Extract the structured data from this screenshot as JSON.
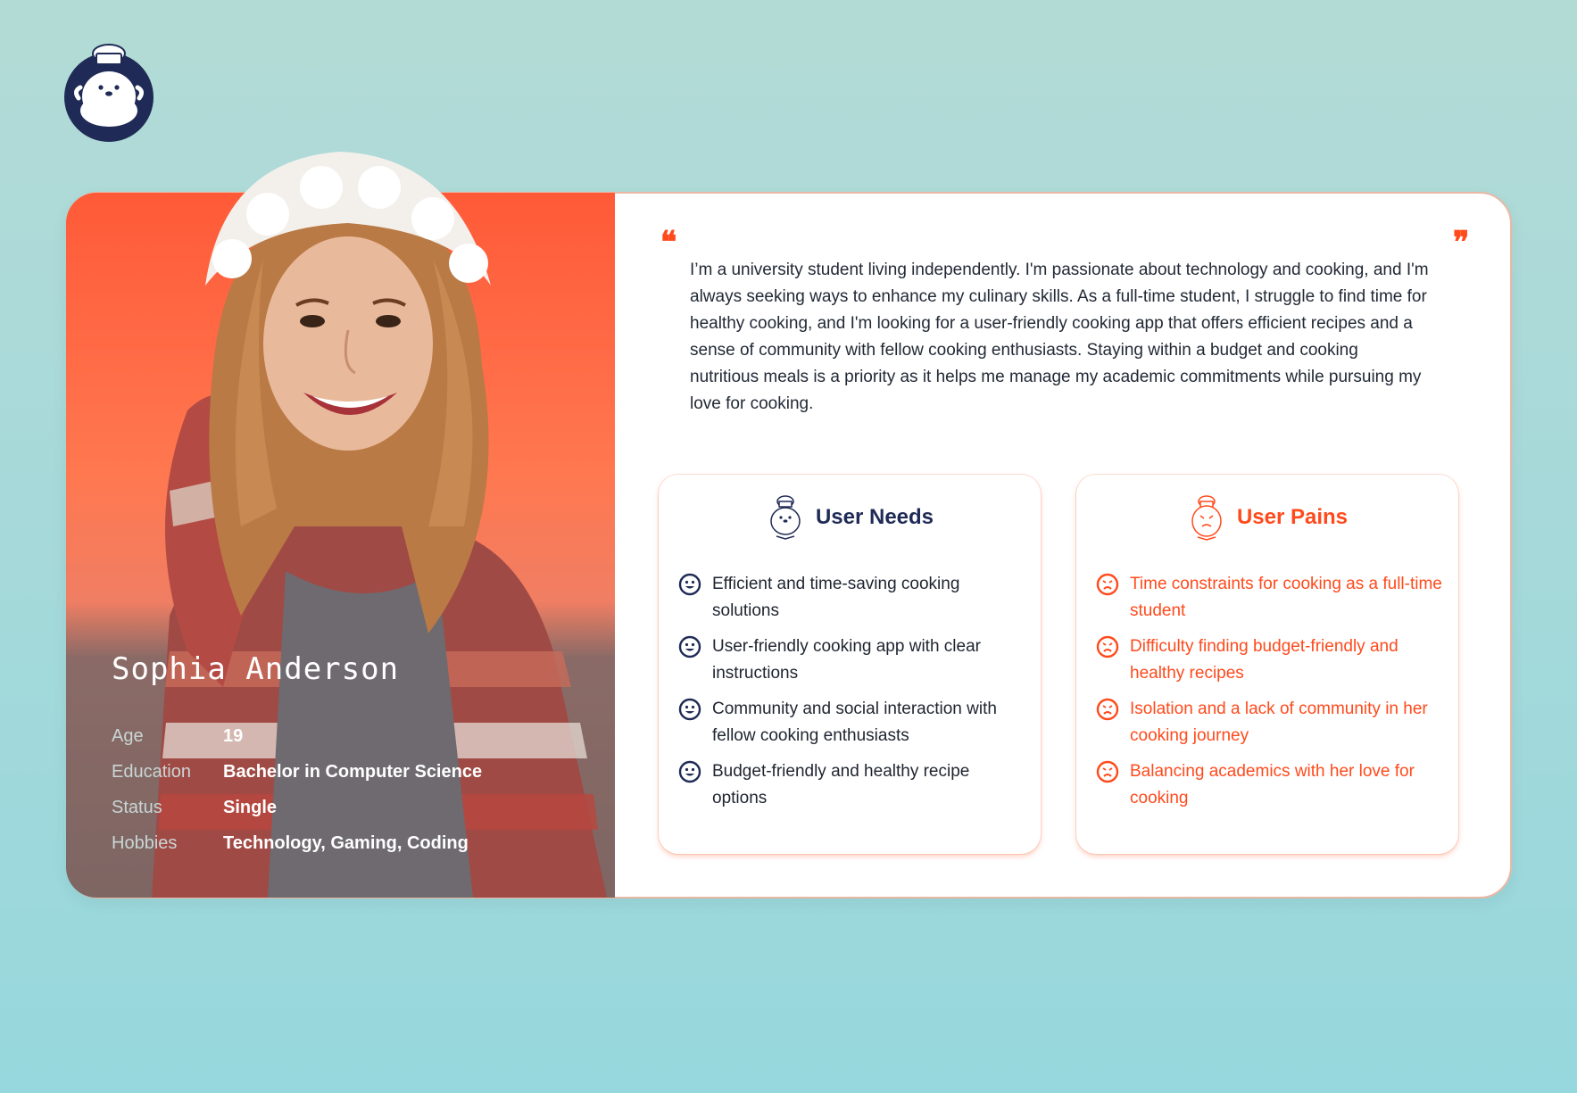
{
  "persona": {
    "name": "Sophia Anderson",
    "details": [
      {
        "label": "Age",
        "value": "19"
      },
      {
        "label": "Education",
        "value": "Bachelor in Computer Science"
      },
      {
        "label": "Status",
        "value": "Single"
      },
      {
        "label": "Hobbies",
        "value": "Technology, Gaming, Coding"
      }
    ],
    "bio": "I’m a university student living independently. I'm passionate about technology and cooking, and I'm always seeking ways to enhance my culinary skills. As a full-time student, I struggle to find time for healthy cooking, and I'm looking for a user-friendly cooking app that offers efficient recipes and a sense of community with fellow cooking enthusiasts. Staying within a budget and cooking nutritious meals is a priority as it helps me manage my academic commitments while pursuing my love for cooking.",
    "quote_open": "❝",
    "quote_close": "❞"
  },
  "needs": {
    "title": "User Needs",
    "icon": "chef-mascot-icon",
    "items": [
      "Efficient and time-saving cooking solutions",
      "User-friendly cooking app with clear instructions",
      "Community and social interaction with fellow cooking enthusiasts",
      "Budget-friendly and healthy recipe options"
    ]
  },
  "pains": {
    "title": "User Pains",
    "icon": "sad-chef-mascot-icon",
    "items": [
      "Time constraints for cooking as a full-time student",
      "Difficulty finding budget-friendly and healthy recipes",
      "Isolation and a lack of community in her cooking journey",
      "Balancing academics with her love for cooking"
    ]
  },
  "colors": {
    "accent": "#ff4a1c",
    "navy": "#1f2b56",
    "background": "#a6d9da"
  }
}
